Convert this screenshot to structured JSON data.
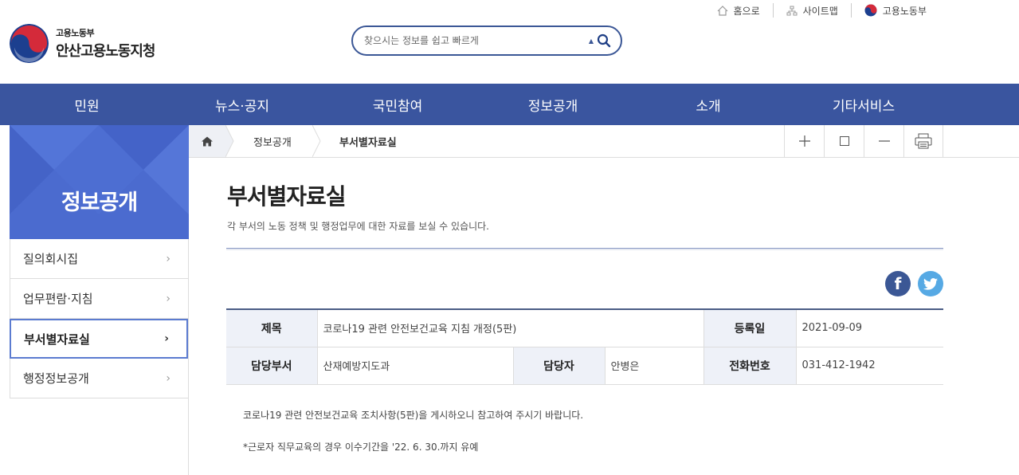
{
  "utility": {
    "home_label": "홈으로",
    "sitemap_label": "사이트맵",
    "ministry_label": "고용노동부"
  },
  "logo": {
    "ministry": "고용노동부",
    "office": "안산고용노동지청"
  },
  "search": {
    "placeholder": "찾으시는 정보를 쉽고 빠르게"
  },
  "gnb": {
    "items": [
      "민원",
      "뉴스·공지",
      "국민참여",
      "정보공개",
      "소개",
      "기타서비스"
    ]
  },
  "sidebar": {
    "title": "정보공개",
    "items": [
      {
        "label": "질의회시집"
      },
      {
        "label": "업무편람·지침"
      },
      {
        "label": "부서별자료실"
      },
      {
        "label": "행정정보공개"
      }
    ]
  },
  "breadcrumb": {
    "level1": "정보공개",
    "current": "부서별자료실"
  },
  "tools": {
    "zoom_in_icon": "plus-icon",
    "reset_icon": "square-icon",
    "zoom_out_icon": "minus-icon",
    "print_icon": "printer-icon"
  },
  "page": {
    "title": "부서별자료실",
    "description": "각 부서의 노동 정책 및 행정업무에 대한 자료를 보실 수 있습니다."
  },
  "sns": {
    "facebook": "f",
    "twitter": "twitter-bird-icon"
  },
  "post": {
    "title_label": "제목",
    "title": "코로나19 관련 안전보건교육 지침 개정(5판)",
    "date_label": "등록일",
    "date": "2021-09-09",
    "dept_label": "담당부서",
    "dept": "산재예방지도과",
    "manager_label": "담당자",
    "manager": "안병은",
    "phone_label": "전화번호",
    "phone": "031-412-1942",
    "body_line1": "코로나19 관련 안전보건교육 조치사항(5판)을 게시하오니 참고하여 주시기 바랍니다.",
    "body_line2": "*근로자 직무교육의 경우 이수기간을 '22. 6. 30.까지 유예"
  },
  "colors": {
    "gnb_bg": "#3a559f",
    "sidebar_hero": "#4b6bcf",
    "table_header_bg": "#eef1f8"
  }
}
